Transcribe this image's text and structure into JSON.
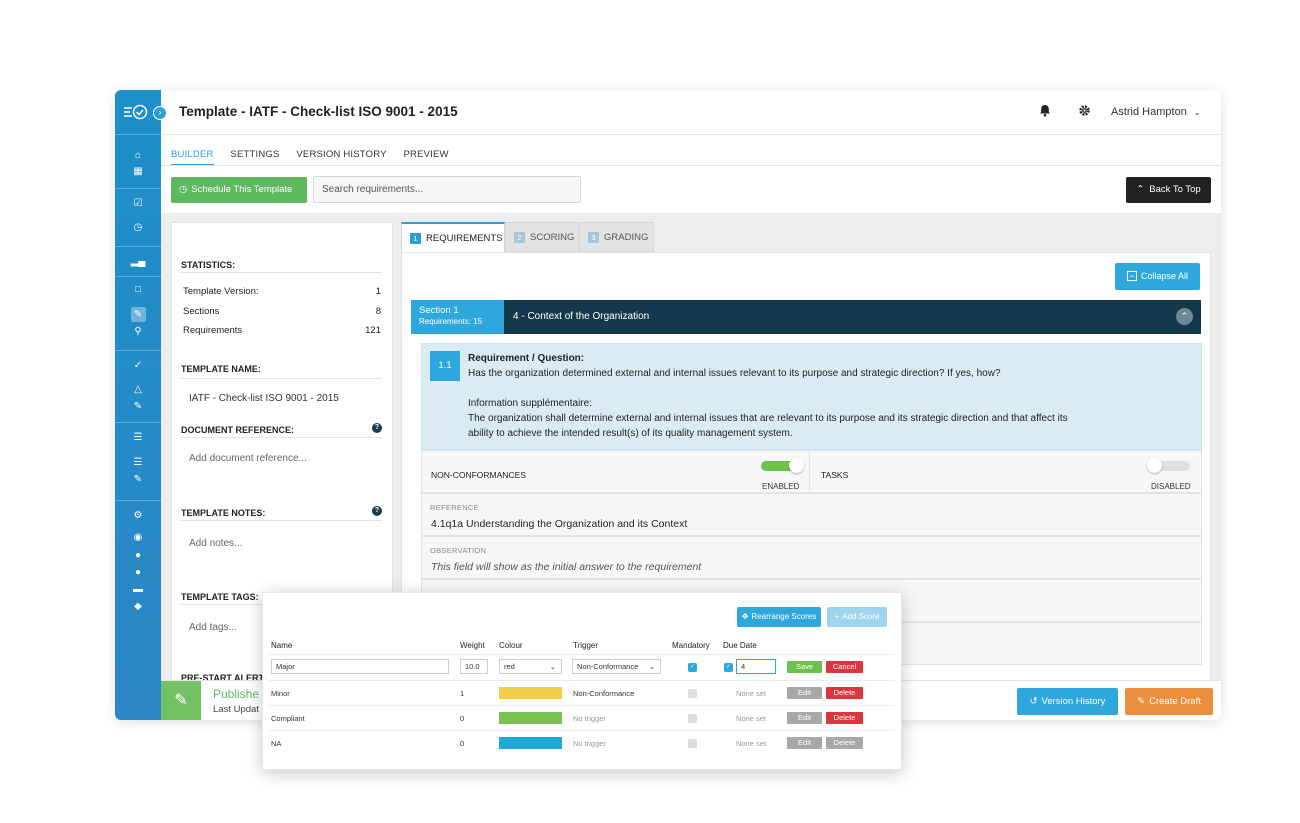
{
  "header": {
    "title": "Template - IATF - Check-list ISO 9001 - 2015",
    "user_name": "Astrid Hampton"
  },
  "tabs": [
    "BUILDER",
    "SETTINGS",
    "VERSION HISTORY",
    "PREVIEW"
  ],
  "toolbar": {
    "schedule_label": "Schedule This Template",
    "search_placeholder": "Search requirements...",
    "back_to_top_label": "Back To Top"
  },
  "left_panel": {
    "statistics_heading": "STATISTICS:",
    "stats": [
      {
        "label": "Template Version:",
        "value": "1"
      },
      {
        "label": "Sections",
        "value": "8"
      },
      {
        "label": "Requirements",
        "value": "121"
      }
    ],
    "template_name_heading": "TEMPLATE NAME:",
    "template_name": "IATF - Check-list ISO 9001 - 2015",
    "doc_ref_heading": "DOCUMENT REFERENCE:",
    "doc_ref_placeholder": "Add document reference...",
    "notes_heading": "TEMPLATE NOTES:",
    "notes_placeholder": "Add notes...",
    "tags_heading": "TEMPLATE TAGS:",
    "tags_placeholder": "Add tags...",
    "prestart_heading": "PRE-START ALERT"
  },
  "right_tabs": [
    {
      "num": "1",
      "label": "REQUIREMENTS"
    },
    {
      "num": "2",
      "label": "SCORING"
    },
    {
      "num": "3",
      "label": "GRADING"
    }
  ],
  "collapse_label": "Collapse All",
  "section": {
    "name": "Section 1",
    "count": "Requirements: 15",
    "title": "4 - Context of the Organization"
  },
  "requirement": {
    "number": "1.1",
    "heading": "Requirement / Question:",
    "question": "Has the organization determined external and internal issues relevant to its purpose and strategic direction? If yes, how?",
    "info_heading": "Information supplémentaire:",
    "info_line1": "The organization shall determine external and internal issues that are relevant to its purpose and its strategic direction and that affect its",
    "info_line2": "ability to achieve the intended result(s) of its quality management system."
  },
  "toggles": {
    "nc_label": "NON-CONFORMANCES",
    "nc_state": "ENABLED",
    "tasks_label": "TASKS",
    "tasks_state": "DISABLED"
  },
  "reference": {
    "label": "REFERENCE",
    "value": "4.1q1a Understanding the Organization and its Context"
  },
  "observation": {
    "label": "OBSERVATION",
    "value": "This field will show as the initial answer to the requirement"
  },
  "footer": {
    "status": "Publishe",
    "updated": "Last Updat",
    "version_history_label": "Version History",
    "create_draft_label": "Create Draft"
  },
  "scores": {
    "rearrange_label": "Rearrange Scores",
    "add_label": "Add Score",
    "columns": [
      "Name",
      "Weight",
      "Colour",
      "Trigger",
      "Mandatory",
      "Due Date"
    ],
    "editing": {
      "name": "Major",
      "weight": "10.0",
      "colour": "red",
      "trigger": "Non-Conformance",
      "due": "4",
      "save": "Save",
      "cancel": "Cancel"
    },
    "rows": [
      {
        "name": "Minor",
        "weight": "1",
        "colour": "#f3cf47",
        "trigger": "Non-Conformance",
        "due": "None set"
      },
      {
        "name": "Compliant",
        "weight": "0",
        "colour": "#7cc14f",
        "trigger": "No trigger",
        "due": "None set"
      },
      {
        "name": "NA",
        "weight": "0",
        "colour": "#1ea7d7",
        "trigger": "No trigger",
        "due": "None set"
      }
    ],
    "edit_label": "Edit",
    "delete_label": "Delete"
  }
}
